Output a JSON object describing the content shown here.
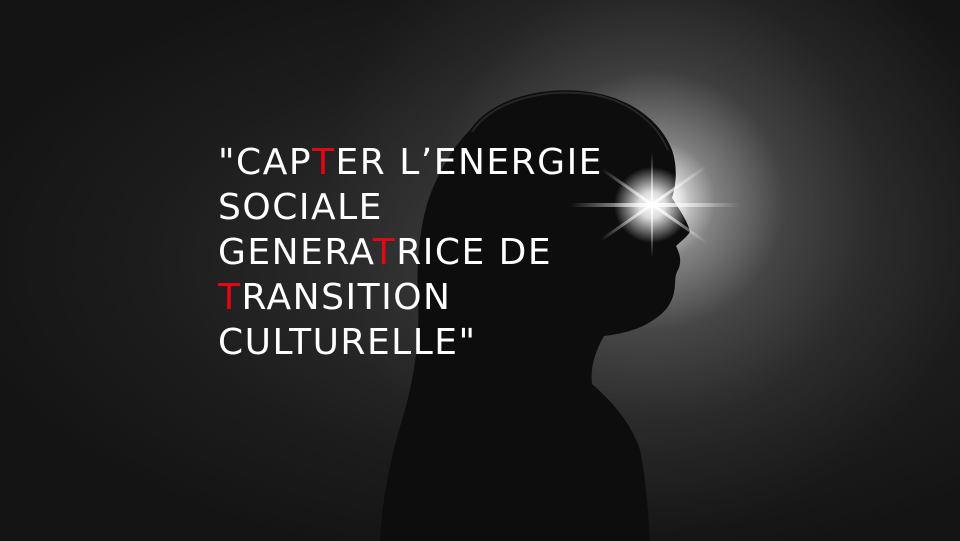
{
  "quote": {
    "line1": {
      "before": "\"CAP",
      "accent": "T",
      "after": "ER L’ENERGIE"
    },
    "line2": {
      "before": "SOCIALE",
      "accent": "",
      "after": ""
    },
    "line3": {
      "before": "GENERA",
      "accent": "T",
      "after": "RICE DE"
    },
    "line4": {
      "before": "",
      "accent": "T",
      "after": "RANSITION"
    },
    "line5": {
      "before": "CULTURELLE\"",
      "accent": "",
      "after": ""
    }
  },
  "colors": {
    "accent": "#e30613",
    "text": "#ffffff",
    "background": "#1a1a1a"
  }
}
